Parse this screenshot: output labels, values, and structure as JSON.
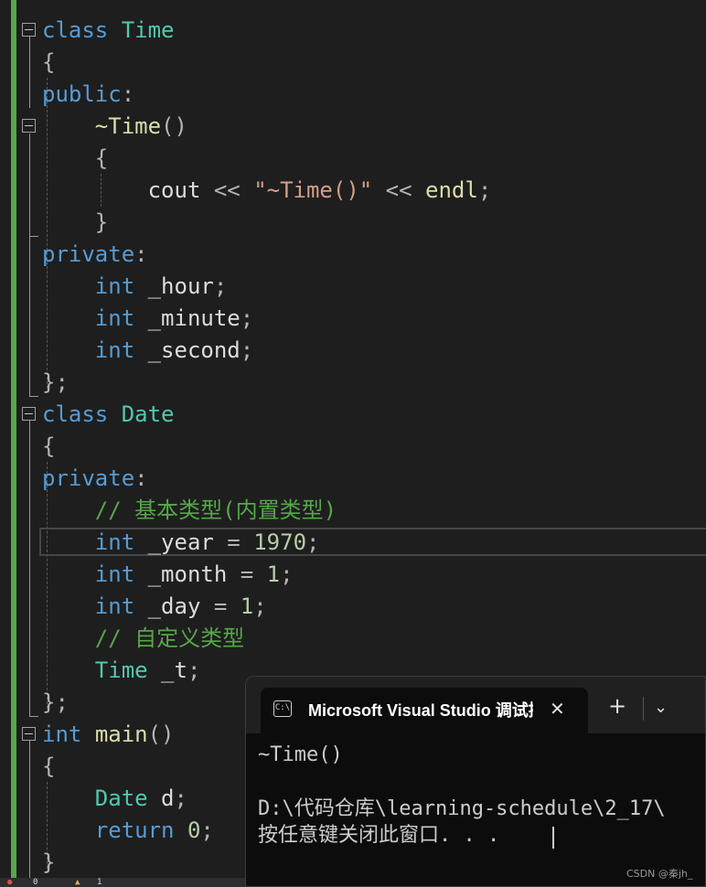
{
  "editor": {
    "lines": [
      {
        "tokens": [
          {
            "t": "class",
            "c": "kw"
          },
          {
            "t": " "
          },
          {
            "t": "Time",
            "c": "ty"
          }
        ]
      },
      {
        "tokens": [
          {
            "t": "{",
            "c": "pn"
          }
        ]
      },
      {
        "tokens": [
          {
            "t": "public",
            "c": "kw"
          },
          {
            "t": ":",
            "c": "pn"
          }
        ]
      },
      {
        "tokens": [
          {
            "t": "    "
          },
          {
            "t": "~Time",
            "c": "fn"
          },
          {
            "t": "()",
            "c": "pn"
          }
        ]
      },
      {
        "tokens": [
          {
            "t": "    "
          },
          {
            "t": "{",
            "c": "pn"
          }
        ]
      },
      {
        "tokens": [
          {
            "t": "        "
          },
          {
            "t": "cout",
            "c": "pl"
          },
          {
            "t": " << ",
            "c": "pn"
          },
          {
            "t": "\"~Time()\"",
            "c": "st"
          },
          {
            "t": " << ",
            "c": "pn"
          },
          {
            "t": "endl",
            "c": "fn"
          },
          {
            "t": ";",
            "c": "pn"
          }
        ]
      },
      {
        "tokens": [
          {
            "t": "    "
          },
          {
            "t": "}",
            "c": "pn"
          }
        ]
      },
      {
        "tokens": [
          {
            "t": "private",
            "c": "kw"
          },
          {
            "t": ":",
            "c": "pn"
          }
        ]
      },
      {
        "tokens": [
          {
            "t": "    "
          },
          {
            "t": "int",
            "c": "kw"
          },
          {
            "t": " _hour",
            "c": "pl"
          },
          {
            "t": ";",
            "c": "pn"
          }
        ]
      },
      {
        "tokens": [
          {
            "t": "    "
          },
          {
            "t": "int",
            "c": "kw"
          },
          {
            "t": " _minute",
            "c": "pl"
          },
          {
            "t": ";",
            "c": "pn"
          }
        ]
      },
      {
        "tokens": [
          {
            "t": "    "
          },
          {
            "t": "int",
            "c": "kw"
          },
          {
            "t": " _second",
            "c": "pl"
          },
          {
            "t": ";",
            "c": "pn"
          }
        ]
      },
      {
        "tokens": [
          {
            "t": "};",
            "c": "pn"
          }
        ]
      },
      {
        "tokens": [
          {
            "t": "class",
            "c": "kw"
          },
          {
            "t": " "
          },
          {
            "t": "Date",
            "c": "ty"
          }
        ]
      },
      {
        "tokens": [
          {
            "t": "{",
            "c": "pn"
          }
        ]
      },
      {
        "tokens": [
          {
            "t": "private",
            "c": "kw"
          },
          {
            "t": ":",
            "c": "pn"
          }
        ]
      },
      {
        "tokens": [
          {
            "t": "    "
          },
          {
            "t": "// 基本类型(内置类型)",
            "c": "cm"
          }
        ]
      },
      {
        "tokens": [
          {
            "t": "    "
          },
          {
            "t": "int",
            "c": "kw"
          },
          {
            "t": " _year",
            "c": "pl"
          },
          {
            "t": " = ",
            "c": "pn"
          },
          {
            "t": "1970",
            "c": "nu"
          },
          {
            "t": ";",
            "c": "pn"
          }
        ]
      },
      {
        "tokens": [
          {
            "t": "    "
          },
          {
            "t": "int",
            "c": "kw"
          },
          {
            "t": " _month",
            "c": "pl"
          },
          {
            "t": " = ",
            "c": "pn"
          },
          {
            "t": "1",
            "c": "nu"
          },
          {
            "t": ";",
            "c": "pn"
          }
        ]
      },
      {
        "tokens": [
          {
            "t": "    "
          },
          {
            "t": "int",
            "c": "kw"
          },
          {
            "t": " _day",
            "c": "pl"
          },
          {
            "t": " = ",
            "c": "pn"
          },
          {
            "t": "1",
            "c": "nu"
          },
          {
            "t": ";",
            "c": "pn"
          }
        ]
      },
      {
        "tokens": [
          {
            "t": "    "
          },
          {
            "t": "// 自定义类型",
            "c": "cm"
          }
        ]
      },
      {
        "tokens": [
          {
            "t": "    "
          },
          {
            "t": "Time",
            "c": "ty"
          },
          {
            "t": " _t",
            "c": "pl"
          },
          {
            "t": ";",
            "c": "pn"
          }
        ]
      },
      {
        "tokens": [
          {
            "t": "};",
            "c": "pn"
          }
        ]
      },
      {
        "tokens": [
          {
            "t": "int",
            "c": "kw"
          },
          {
            "t": " "
          },
          {
            "t": "main",
            "c": "fn"
          },
          {
            "t": "()",
            "c": "pn"
          }
        ]
      },
      {
        "tokens": [
          {
            "t": "{",
            "c": "pn"
          }
        ]
      },
      {
        "tokens": [
          {
            "t": "    "
          },
          {
            "t": "Date",
            "c": "ty"
          },
          {
            "t": " d",
            "c": "pl"
          },
          {
            "t": ";",
            "c": "pn"
          }
        ]
      },
      {
        "tokens": [
          {
            "t": "    "
          },
          {
            "t": "return",
            "c": "kw"
          },
          {
            "t": " "
          },
          {
            "t": "0",
            "c": "nu"
          },
          {
            "t": ";",
            "c": "pn"
          }
        ]
      },
      {
        "tokens": [
          {
            "t": "}",
            "c": "pn"
          }
        ]
      }
    ]
  },
  "console": {
    "icon_text": "C:\\",
    "tab_title": "Microsoft Visual Studio 调试控制台",
    "close_glyph": "✕",
    "new_tab_glyph": "+",
    "dropdown_glyph": "⌄",
    "output": [
      "~Time()",
      "",
      "D:\\代码仓库\\learning-schedule\\2_17\\",
      "按任意键关闭此窗口. . ."
    ]
  },
  "status": {
    "errors": "0",
    "warnings": "1"
  },
  "watermark": "CSDN @秦jh_",
  "colors": {
    "keyword": "#569cd6",
    "type": "#4ec9b0",
    "function": "#dcdcaa",
    "string": "#d69d85",
    "comment": "#57a64a",
    "number": "#b5cea8",
    "change_bar": "#57a64a"
  }
}
